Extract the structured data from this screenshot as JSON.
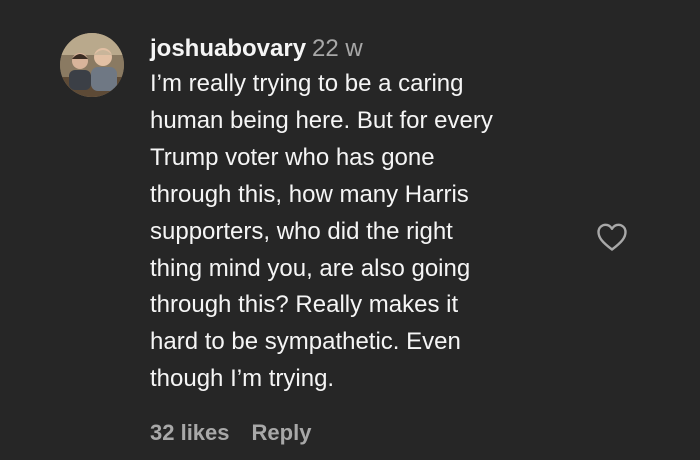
{
  "comment": {
    "username": "joshuabovary",
    "timestamp": "22 w",
    "text_lines": [
      "I’m really trying to be a caring",
      "human being here. But for every",
      "Trump voter who has gone",
      "through this, how many Harris",
      "supporters, who did the right",
      "thing mind you, are also going",
      "through this? Really makes it",
      "hard to be sympathetic. Even",
      "though I’m trying."
    ],
    "likes": "32 likes",
    "reply_label": "Reply",
    "like_icon": "heart-outline-icon"
  },
  "colors": {
    "background": "#262626",
    "primary_text": "#f5f5f5",
    "secondary_text": "#a8a8a8"
  }
}
